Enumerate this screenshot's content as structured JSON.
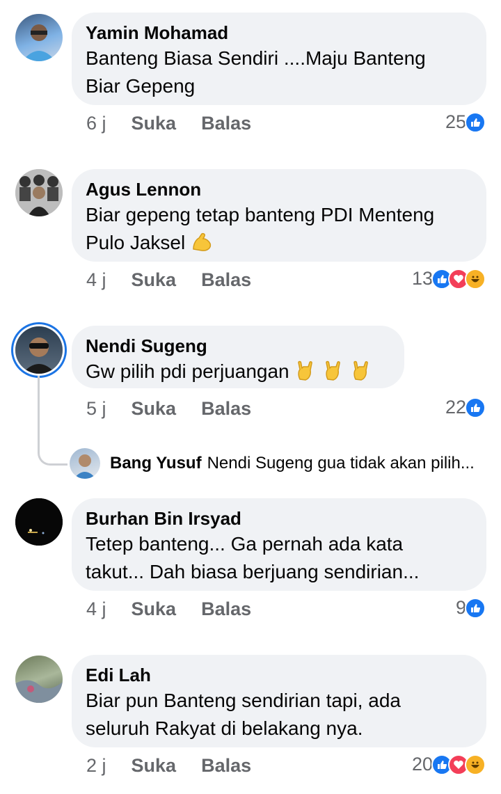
{
  "comments": [
    {
      "name": "Yamin Mohamad",
      "lines": [
        "Banteng Biasa Sendiri ....Maju Banteng",
        "Biar Gepeng"
      ],
      "time": "6 j",
      "like": "Suka",
      "reply": "Balas",
      "count": "25"
    },
    {
      "name": "Agus Lennon",
      "lines": [
        "Biar gepeng tetap banteng PDI Menteng",
        "Pulo Jaksel"
      ],
      "time": "4 j",
      "like": "Suka",
      "reply": "Balas",
      "count": "13"
    },
    {
      "name": "Nendi Sugeng",
      "lines": [
        "Gw pilih pdi perjuangan"
      ],
      "time": "5 j",
      "like": "Suka",
      "reply": "Balas",
      "count": "22"
    },
    {
      "name": "Burhan Bin Irsyad",
      "lines": [
        "Tetep banteng... Ga pernah ada kata",
        "takut... Dah biasa berjuang sendirian..."
      ],
      "time": "4 j",
      "like": "Suka",
      "reply": "Balas",
      "count": "9"
    },
    {
      "name": "Edi Lah",
      "lines": [
        "Biar pun Banteng sendirian tapi, ada",
        "seluruh Rakyat di belakang nya."
      ],
      "time": "2 j",
      "like": "Suka",
      "reply": "Balas",
      "count": "20"
    }
  ],
  "reply_preview": {
    "name": "Bang Yusuf",
    "text": "Nendi Sugeng gua tidak akan pilih..."
  },
  "icons": {
    "like": "like-reaction-icon",
    "love": "love-reaction-icon",
    "haha": "haha-reaction-icon",
    "muscle": "flexed-biceps-emoji",
    "rock": "sign-of-horns-emoji"
  },
  "colors": {
    "bubble": "#f0f2f5",
    "meta": "#65676b",
    "like": "#1877f2",
    "love": "#f33e58",
    "haha": "#f7b125",
    "ring": "#1b74e4"
  }
}
